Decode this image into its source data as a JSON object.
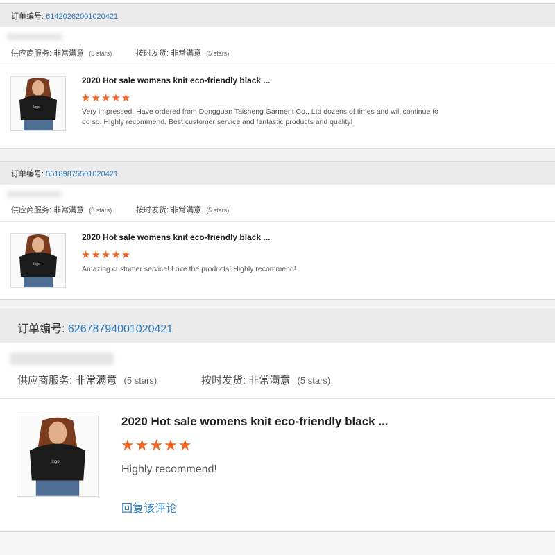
{
  "colors": {
    "link": "#2b7bc0",
    "star": "#f26522",
    "header_bg": "#ebebeb"
  },
  "reviews": [
    {
      "order_label": "订单编号:",
      "order_no": "61420262001020421",
      "supplier_label": "供应商服务:",
      "supplier_value": "非常满意",
      "supplier_stars": "(5 stars)",
      "ship_label": "按时发货:",
      "ship_value": "非常满意",
      "ship_stars": "(5 stars)",
      "product_title": "2020 Hot sale womens knit eco-friendly black ...",
      "rating": 5,
      "stars": "★★★★★",
      "review_text": "Very impressed. Have ordered from Dongguan Taisheng Garment Co., Ltd dozens of times and will continue to do so. Highly recommend. Best customer service and fantastic products and quality!",
      "logo_text": "logo"
    },
    {
      "order_label": "订单编号:",
      "order_no": "55189875501020421",
      "supplier_label": "供应商服务:",
      "supplier_value": "非常满意",
      "supplier_stars": "(5 stars)",
      "ship_label": "按时发货:",
      "ship_value": "非常满意",
      "ship_stars": "(5 stars)",
      "product_title": "2020 Hot sale womens knit eco-friendly black ...",
      "rating": 5,
      "stars": "★★★★★",
      "review_text": "Amazing customer service! Love the products! Highly recommend!",
      "logo_text": "logo"
    },
    {
      "order_label": "订单编号:",
      "order_no": "62678794001020421",
      "supplier_label": "供应商服务:",
      "supplier_value": "非常满意",
      "supplier_stars": "(5 stars)",
      "ship_label": "按时发货:",
      "ship_value": "非常满意",
      "ship_stars": "(5 stars)",
      "product_title": "2020 Hot sale womens knit eco-friendly black ...",
      "rating": 5,
      "stars": "★★★★★",
      "review_text": "Highly recommend!",
      "reply_label": "回复该评论",
      "logo_text": "logo"
    }
  ]
}
